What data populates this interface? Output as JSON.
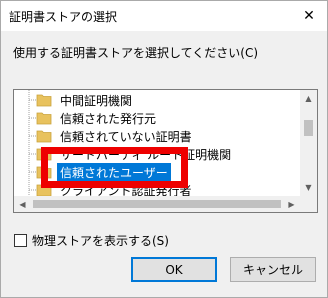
{
  "window": {
    "title": "証明書ストアの選択",
    "close_label": "✕"
  },
  "instruction": "使用する証明書ストアを選択してください(C)",
  "tree": {
    "items": [
      {
        "label": "中間証明機関",
        "selected": false
      },
      {
        "label": "信頼された発行元",
        "selected": false
      },
      {
        "label": "信頼されていない証明書",
        "selected": false
      },
      {
        "label": "サードパーティ ルート証明機関",
        "selected": false
      },
      {
        "label": "信頼されたユーザー",
        "selected": true
      },
      {
        "label": "クライアント認証発行者",
        "selected": false
      }
    ]
  },
  "scroll": {
    "up": "▲",
    "down": "▼",
    "left": "◀",
    "right": "▶"
  },
  "checkbox": {
    "label": "物理ストアを表示する(S)",
    "checked": false
  },
  "buttons": {
    "ok": "OK",
    "cancel": "キャンセル"
  },
  "colors": {
    "selection": "#0078d7",
    "highlight_frame": "#ee0000",
    "folder": "#e8c25e"
  },
  "icons": {
    "folder": "folder-icon",
    "close": "close-icon"
  }
}
